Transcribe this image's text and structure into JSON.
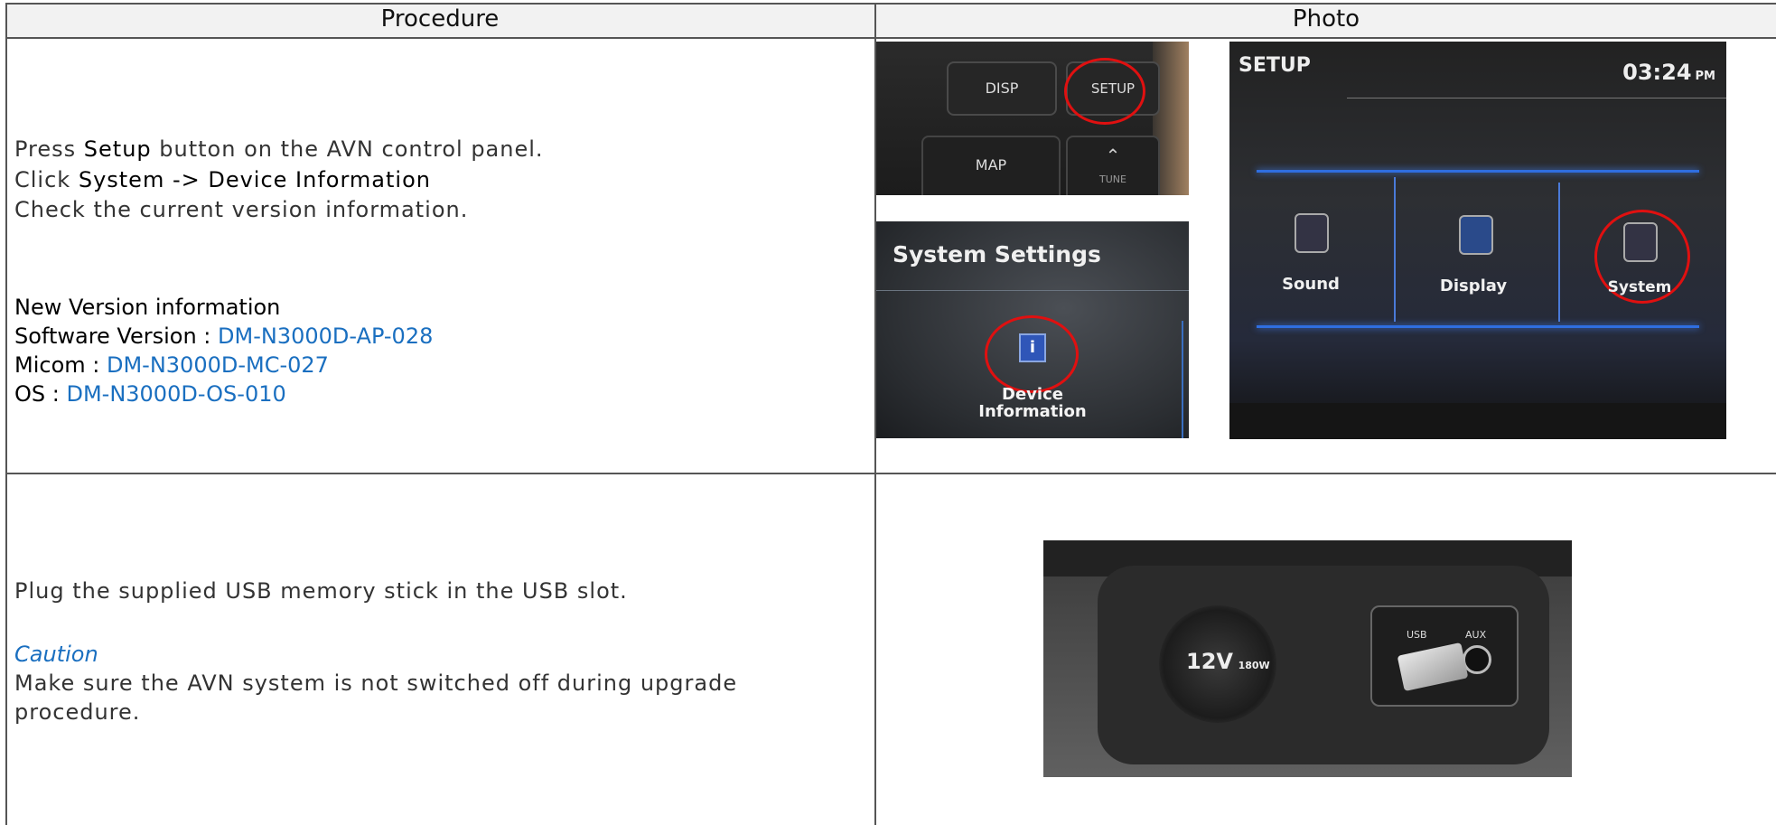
{
  "header": {
    "procedure_label": "Procedure",
    "photo_label": "Photo"
  },
  "row1": {
    "line1_prefix": "Press ",
    "line1_strong": "Setup",
    "line1_suffix": " button on the AVN control panel.",
    "line2_prefix": "Click ",
    "line2_strong": "System -> Device Information",
    "line3": "Check the current version information.",
    "new_version_title": "New Version information",
    "software_label": "Software Version : ",
    "software_value": "DM-N3000D-AP-028",
    "micom_label": "Micom : ",
    "micom_value": "DM-N3000D-MC-027",
    "os_label": "OS : ",
    "os_value": "DM-N3000D-OS-010",
    "photo_panel": {
      "disp": "DISP",
      "setup": "SETUP",
      "map": "MAP",
      "tune": "TUNE"
    },
    "photo_settings": {
      "title": "System Settings",
      "item_line1": "Device",
      "item_line2": "Information"
    },
    "photo_setup": {
      "title": "SETUP",
      "time": "03:24",
      "ampm": "PM",
      "sound": "Sound",
      "display": "Display",
      "system": "System"
    }
  },
  "row2": {
    "line1": "Plug the supplied USB memory stick in the USB slot.",
    "caution": "Caution",
    "caution_line1": "Make sure the AVN system is not switched off during upgrade",
    "caution_line2": "procedure.",
    "photo_usb": {
      "power_label": "12V",
      "power_watt": "180W",
      "usb": "USB",
      "aux": "AUX"
    }
  },
  "colors": {
    "link_blue": "#1a6fc0",
    "highlight_red": "#e01010"
  }
}
